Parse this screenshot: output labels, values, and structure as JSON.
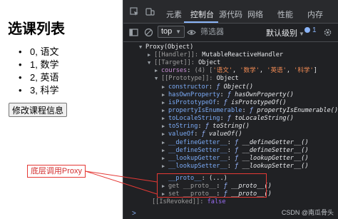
{
  "page": {
    "title": "选课列表",
    "courses": [
      "0, 语文",
      "1, 数学",
      "2, 英语",
      "3, 科学"
    ],
    "button_label": "修改课程信息"
  },
  "devtools": {
    "tabs": [
      "元素",
      "控制台",
      "源代码",
      "网络",
      "性能",
      "内存"
    ],
    "active_tab": "控制台",
    "context": "top",
    "filter_placeholder": "筛选器",
    "level_label": "默认级别",
    "issues_count": "1"
  },
  "console": {
    "header": "Proxy(Object)",
    "handler_key": "[[Handler]]",
    "handler_value": "MutableReactiveHandler",
    "target_key": "[[Target]]",
    "target_value": "Object",
    "courses_key": "courses",
    "courses_prefix": "(4) [",
    "course_items": [
      "'语文'",
      "'数学'",
      "'英语'",
      "'科学'"
    ],
    "prototype_key": "[[Prototype]]",
    "prototype_value": "Object",
    "proto_members": [
      {
        "key": "constructor",
        "value": "Object()"
      },
      {
        "key": "hasOwnProperty",
        "value": "hasOwnProperty()"
      },
      {
        "key": "isPrototypeOf",
        "value": "isPrototypeOf()"
      },
      {
        "key": "propertyIsEnumerable",
        "value": "propertyIsEnumerable()"
      },
      {
        "key": "toLocaleString",
        "value": "toLocaleString()"
      },
      {
        "key": "toString",
        "value": "toString()"
      },
      {
        "key": "valueOf",
        "value": "valueOf()"
      },
      {
        "key": "__defineGetter__",
        "value": "__defineGetter__()"
      },
      {
        "key": "__defineSetter__",
        "value": "__defineSetter__()"
      },
      {
        "key": "__lookupGetter__",
        "value": "__lookupGetter__()"
      },
      {
        "key": "__lookupSetter__",
        "value": "__lookupSetter__()"
      }
    ],
    "proto_row": {
      "key": "__proto__",
      "value": "(...)"
    },
    "get_proto": {
      "key": "get __proto__",
      "value": "__proto__()"
    },
    "set_proto": {
      "key": "set __proto__",
      "value": "__proto__()"
    },
    "revoked_key": "[[IsRevoked]]",
    "revoked_value": "false"
  },
  "annotation": {
    "label": "底层调用Proxy"
  },
  "watermark": "CSDN @南瓜骨头",
  "colors": {
    "devtools_bg": "#202124",
    "accent": "#8ab4f8",
    "annotation": "#e53935"
  }
}
